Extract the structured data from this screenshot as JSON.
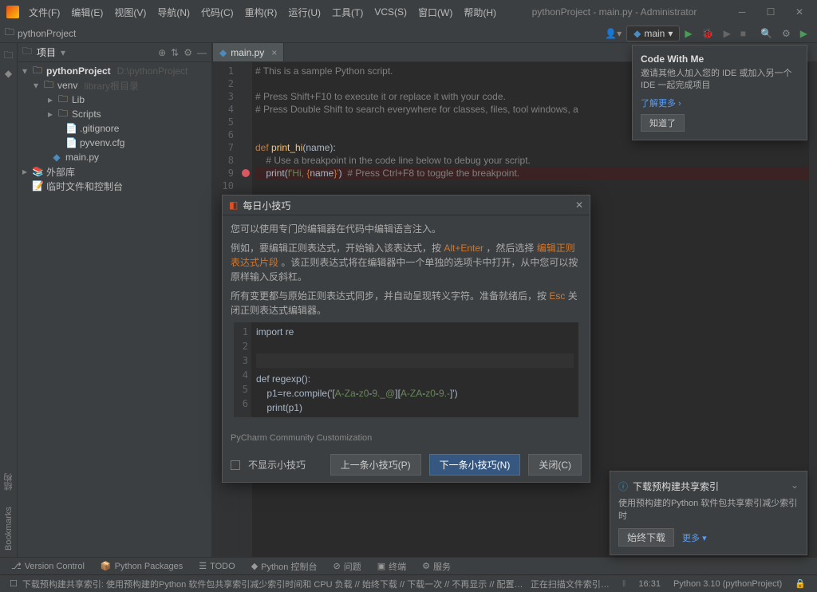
{
  "titlebar": {
    "menus": [
      "文件(F)",
      "编辑(E)",
      "视图(V)",
      "导航(N)",
      "代码(C)",
      "重构(R)",
      "运行(U)",
      "工具(T)",
      "VCS(S)",
      "窗口(W)",
      "帮助(H)"
    ],
    "title": "pythonProject - main.py - Administrator"
  },
  "breadcrumb": {
    "project": "pythonProject",
    "run_config": "main"
  },
  "sidebar": {
    "title": "项目",
    "tree": {
      "root": "pythonProject",
      "root_path": "D:\\pythonProject",
      "venv": "venv",
      "venv_hint": "library根目录",
      "lib": "Lib",
      "scripts": "Scripts",
      "gitignore": ".gitignore",
      "pyvenv": "pyvenv.cfg",
      "main": "main.py",
      "ext": "外部库",
      "scratch": "临时文件和控制台"
    }
  },
  "tabs": {
    "main": "main.py"
  },
  "editor": {
    "lines": {
      "l1": "# This is a sample Python script.",
      "l2": "",
      "l3": "# Press Shift+F10 to execute it or replace it with your code.",
      "l4": "# Press Double Shift to search everywhere for classes, files, tool windows, a",
      "l5": "",
      "l6": "",
      "l7_def": "def ",
      "l7_fn": "print_hi",
      "l7_rest": "(name):",
      "l8": "    # Use a breakpoint in the code line below to debug your script.",
      "l9_print": "    print",
      "l9_open": "(",
      "l9_f": "f'Hi, ",
      "l9_brace": "{",
      "l9_name": "name",
      "l9_bclose": "}",
      "l9_sq": "'",
      "l9_close": ")",
      "l9_comment": "  # Press Ctrl+F8 to toggle the breakpoint.",
      "l10": "",
      "l11": ""
    }
  },
  "tips": {
    "title": "每日小技巧",
    "p1": "您可以使用专门的编辑器在代码中编辑语言注入。",
    "p2a": "例如，要编辑正则表达式，开始输入该表达式，按 ",
    "p2_k1": "Alt+Enter",
    "p2b": " ，然后选择 ",
    "p2_k2": "编辑正则表达式片段",
    "p2c": " 。该正则表达式将在编辑器中一个单独的选项卡中打开，从中您可以按原样输入反斜杠。",
    "p3a": "所有变更都与原始正则表达式同步，并自动呈现转义字符。准备就绪后，按 ",
    "p3_k1": "Esc",
    "p3b": " 关闭正则表达式编辑器。",
    "code": {
      "l1_import": "import ",
      "l1_re": "re",
      "l4_def": "def ",
      "l4_fn": "regexp",
      "l4_rest": "():",
      "l5_a": "    p1=re.compile(",
      "l5_s1": "'[",
      "l5_c1": "A-Za",
      "l5_d1": "-",
      "l5_c2": "z0",
      "l5_d2": "-",
      "l5_c3": "9._@",
      "l5_s2": "][",
      "l5_c4": "A-ZA",
      "l5_d3": "-",
      "l5_c5": "z0",
      "l5_d4": "-",
      "l5_c6": "9.-",
      "l5_s3": "]'",
      "l5_b": ")",
      "l6_a": "    print",
      "l6_b": "(p1)"
    },
    "footer": "PyCharm Community Customization",
    "checkbox": "不显示小技巧",
    "prev": "上一条小技巧(P)",
    "next": "下一条小技巧(N)",
    "close": "关闭(C)"
  },
  "cwm": {
    "title": "Code With Me",
    "desc": "邀请其他人加入您的 IDE 或加入另一个 IDE 一起完成项目",
    "link": "了解更多 ›",
    "got_it": "知道了"
  },
  "index": {
    "title": "下载预构建共享索引",
    "desc": "使用预构建的Python 软件包共享索引减少索引时",
    "download": "始终下载",
    "more": "更多 ▾"
  },
  "bottom": {
    "vc": "Version Control",
    "pkg": "Python Packages",
    "todo": "TODO",
    "pyconsole": "Python 控制台",
    "problems": "问题",
    "terminal": "终端",
    "services": "服务"
  },
  "status": {
    "msg": "下载预构建共享索引: 使用预构建的Python 软件包共享索引减少索引时间和 CPU 负载 // 始终下载 // 下载一次 // 不再显示 // 配置…",
    "scan": "正在扫描文件索引…",
    "time": "16:31",
    "interp": "Python 3.10 (pythonProject)"
  },
  "bookmarks": "Bookmarks",
  "structure": "结构"
}
